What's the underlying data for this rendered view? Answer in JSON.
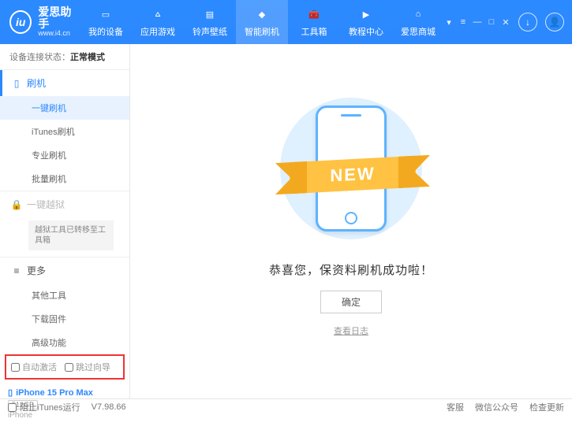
{
  "brand": {
    "logo_text": "iu",
    "title": "爱思助手",
    "url": "www.i4.cn"
  },
  "nav": [
    {
      "label": "我的设备"
    },
    {
      "label": "应用游戏"
    },
    {
      "label": "铃声壁纸"
    },
    {
      "label": "智能刷机"
    },
    {
      "label": "工具箱"
    },
    {
      "label": "教程中心"
    },
    {
      "label": "爱思商城"
    }
  ],
  "sidebar": {
    "conn_label": "设备连接状态：",
    "conn_value": "正常模式",
    "sec_flash": "刷机",
    "items_flash": [
      "一键刷机",
      "iTunes刷机",
      "专业刷机",
      "批量刷机"
    ],
    "sec_jail": "一键越狱",
    "jail_note": "越狱工具已转移至工具箱",
    "sec_more": "更多",
    "items_more": [
      "其他工具",
      "下载固件",
      "高级功能"
    ],
    "check_auto": "自动激活",
    "check_skip": "跳过向导"
  },
  "device": {
    "name": "iPhone 15 Pro Max",
    "capacity": "512GB",
    "type": "iPhone"
  },
  "main": {
    "ribbon": "NEW",
    "message": "恭喜您，保资料刷机成功啦！",
    "ok": "确定",
    "log": "查看日志"
  },
  "footer": {
    "block_itunes": "阻止iTunes运行",
    "version": "V7.98.66",
    "links": [
      "客服",
      "微信公众号",
      "检查更新"
    ]
  }
}
